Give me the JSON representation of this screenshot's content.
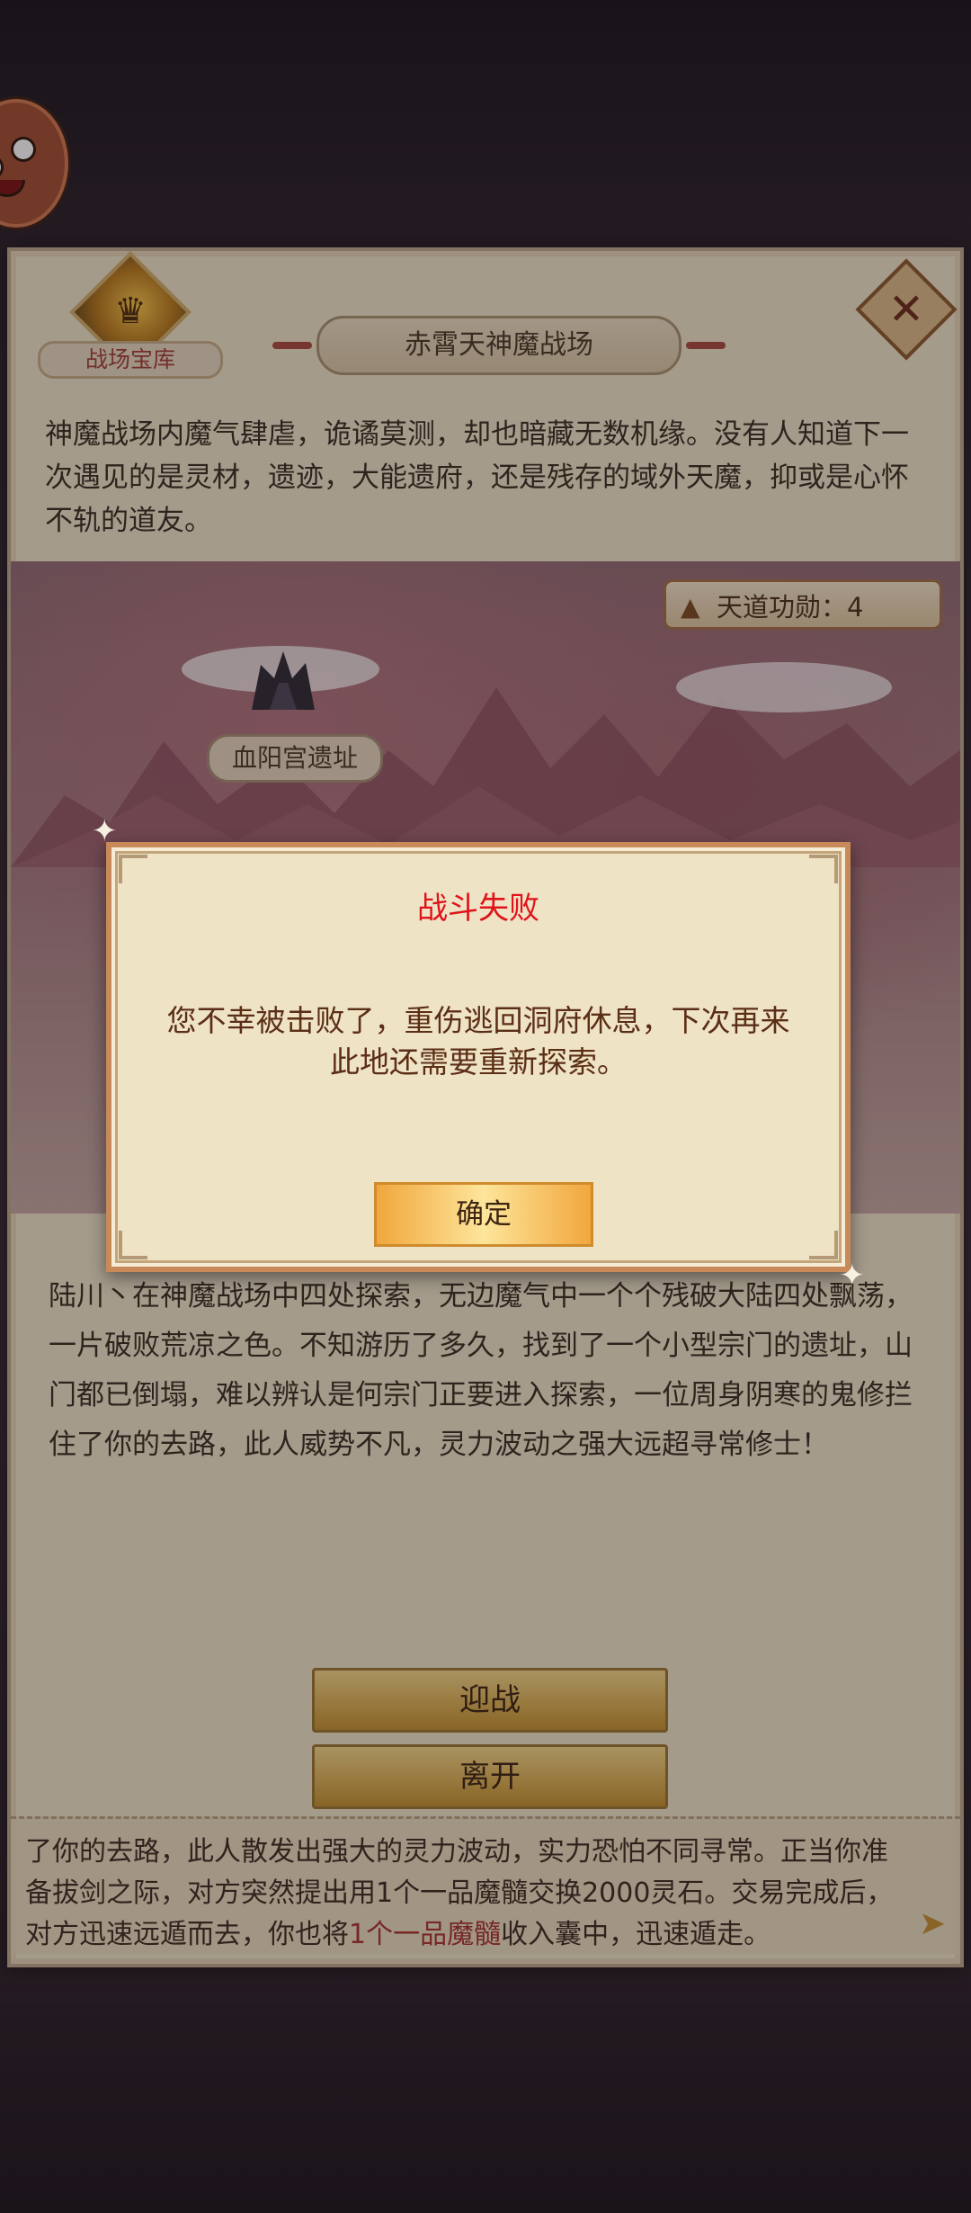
{
  "header": {
    "treasury_label": "战场宝库",
    "title": "赤霄天神魔战场",
    "close_icon": "✕"
  },
  "intro_text": "神魔战场内魔气肆虐，诡谲莫测，却也暗藏无数机缘。没有人知道下一次遇见的是灵材，遗迹，大能遗府，还是残存的域外天魔，抑或是心怀不轨的道友。",
  "map": {
    "merit_label": "天道功勋：",
    "merit_value": "4",
    "location_label": "血阳宫遗址"
  },
  "story_text": "陆川丶在神魔战场中四处探索，无边魔气中一个个残破大陆四处飘荡，一片破败荒凉之色。不知游历了多久，找到了一个小型宗门的遗址，山门都已倒塌，难以辨认是何宗门正要进入探索，一位周身阴寒的鬼修拦住了你的去路，此人威势不凡，灵力波动之强大远超寻常修士！",
  "actions": {
    "fight_label": "迎战",
    "leave_label": "离开"
  },
  "log": {
    "line1": "了你的去路，此人散发出强大的灵力波动，实力恐怕不同寻常。正当你准",
    "line2": "备拔剑之际，对方突然提出用1个一品魔髓交换2000灵石。交易完成后，",
    "line3_pre": "对方迅速远遁而去，你也将",
    "line3_hl": "1个一品魔髓",
    "line3_post": "收入囊中，迅速遁走。"
  },
  "dialog": {
    "title": "战斗失败",
    "message": "您不幸被击败了，重伤逃回洞府休息，下次再来此地还需要重新探索。",
    "confirm_label": "确定"
  },
  "colors": {
    "dialog_title": "#e0131a",
    "highlight": "#a8322c",
    "button_gold": "#d9ad4f"
  }
}
